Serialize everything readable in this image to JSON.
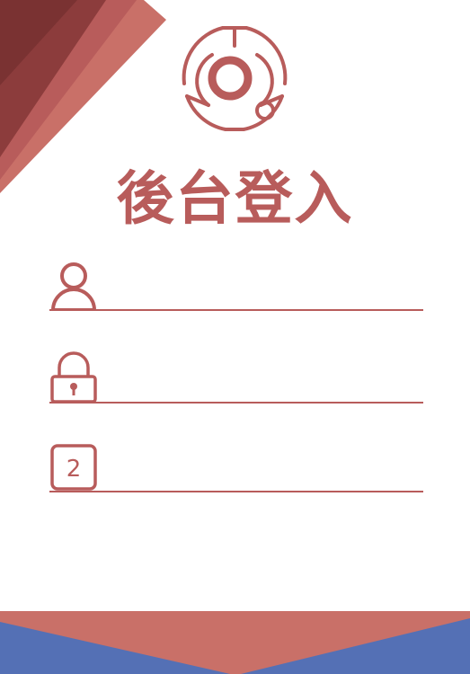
{
  "login": {
    "title": "後台登入",
    "username_placeholder": "",
    "password_placeholder": "",
    "captcha_placeholder": "",
    "captcha_icon_text": "2"
  },
  "colors": {
    "accent": "#b85c5b",
    "dark_accent": "#8c3c3c",
    "light_accent": "#c97068",
    "blue": "#5470b5"
  },
  "icons": {
    "logo": "target-ring-logo",
    "username": "user-icon",
    "password": "lock-icon",
    "captcha": "number-box-icon"
  }
}
